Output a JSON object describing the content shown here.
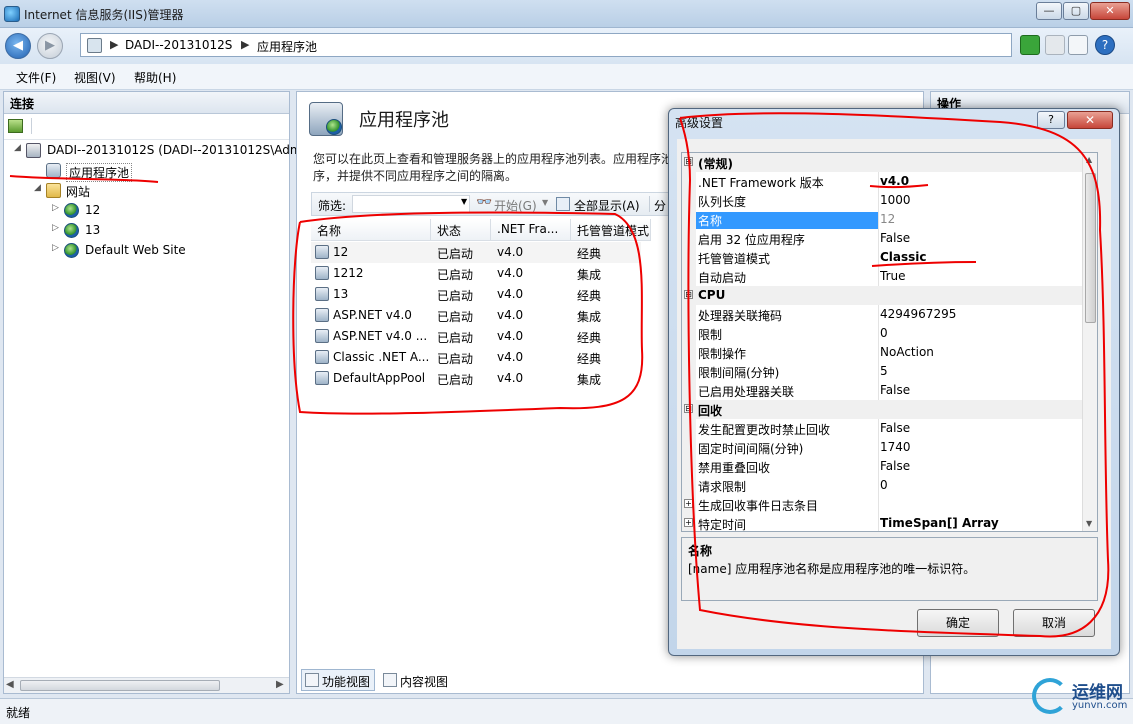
{
  "window": {
    "title": "Internet 信息服务(IIS)管理器"
  },
  "address": {
    "crumbs": [
      "DADI--20131012S",
      "应用程序池"
    ]
  },
  "menu": {
    "items": [
      "文件(F)",
      "视图(V)",
      "帮助(H)"
    ]
  },
  "connections": {
    "header": "连接",
    "tree": {
      "server": "DADI--20131012S (DADI--20131012S\\Adm",
      "app_pools": "应用程序池",
      "sites": "网站",
      "site_items": [
        "12",
        "13",
        "Default Web Site"
      ]
    }
  },
  "main": {
    "title": "应用程序池",
    "description_line1": "您可以在此页上查看和管理服务器上的应用程序池列表。应用程序池",
    "description_line2": "序，并提供不同应用程序之间的隔离。",
    "filter_label": "筛选:",
    "start_label": "开始(G)",
    "show_all_label": "全部显示(A)",
    "group_label": "分",
    "columns": [
      "名称",
      "状态",
      ".NET Fra...",
      "托管管道模式"
    ],
    "rows": [
      {
        "name": "12",
        "status": "已启动",
        "net": "v4.0",
        "mode": "经典"
      },
      {
        "name": "1212",
        "status": "已启动",
        "net": "v4.0",
        "mode": "集成"
      },
      {
        "name": "13",
        "status": "已启动",
        "net": "v4.0",
        "mode": "经典"
      },
      {
        "name": "ASP.NET v4.0",
        "status": "已启动",
        "net": "v4.0",
        "mode": "集成"
      },
      {
        "name": "ASP.NET v4.0 ...",
        "status": "已启动",
        "net": "v4.0",
        "mode": "经典"
      },
      {
        "name": "Classic .NET A...",
        "status": "已启动",
        "net": "v4.0",
        "mode": "经典"
      },
      {
        "name": "DefaultAppPool",
        "status": "已启动",
        "net": "v4.0",
        "mode": "集成"
      }
    ],
    "tabs": {
      "features": "功能视图",
      "content": "内容视图"
    }
  },
  "actions": {
    "header": "操作"
  },
  "status": {
    "text": "就绪"
  },
  "dialog": {
    "title": "高级设置",
    "help": "?",
    "close": "✕",
    "properties": [
      {
        "type": "category",
        "name": "(常规)",
        "toggle": "⊟"
      },
      {
        "name": ".NET Framework 版本",
        "value": "v4.0",
        "bold": true
      },
      {
        "name": "队列长度",
        "value": "1000"
      },
      {
        "name": "名称",
        "value": "12",
        "selected": true
      },
      {
        "name": "启用 32 位应用程序",
        "value": "False"
      },
      {
        "name": "托管管道模式",
        "value": "Classic",
        "bold": true
      },
      {
        "name": "自动启动",
        "value": "True"
      },
      {
        "type": "category",
        "name": "CPU",
        "toggle": "⊟"
      },
      {
        "name": "处理器关联掩码",
        "value": "4294967295"
      },
      {
        "name": "限制",
        "value": "0"
      },
      {
        "name": "限制操作",
        "value": "NoAction"
      },
      {
        "name": "限制间隔(分钟)",
        "value": "5"
      },
      {
        "name": "已启用处理器关联",
        "value": "False"
      },
      {
        "type": "category",
        "name": "回收",
        "toggle": "⊟"
      },
      {
        "name": "发生配置更改时禁止回收",
        "value": "False"
      },
      {
        "name": "固定时间间隔(分钟)",
        "value": "1740"
      },
      {
        "name": "禁用重叠回收",
        "value": "False"
      },
      {
        "name": "请求限制",
        "value": "0"
      },
      {
        "name": "生成回收事件日志条目",
        "value": "",
        "expander": true
      },
      {
        "name": "特定时间",
        "value": "TimeSpan[] Array",
        "bold": true,
        "expander": true
      }
    ],
    "desc_title": "名称",
    "desc_text": "[name] 应用程序池名称是应用程序池的唯一标识符。",
    "ok": "确定",
    "cancel": "取消"
  },
  "watermark": {
    "text": "运维网",
    "url": "yunvn.com"
  }
}
